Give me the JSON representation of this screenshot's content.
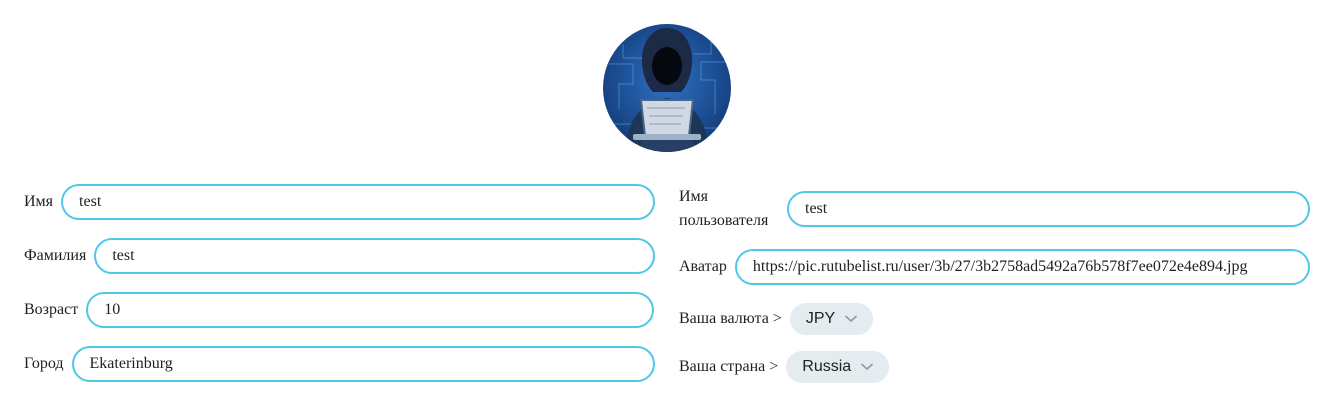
{
  "profile": {
    "avatar_icon": "hacker-avatar-icon",
    "first_name": {
      "label": "Имя",
      "value": "test"
    },
    "last_name": {
      "label": "Фамилия",
      "value": "test"
    },
    "age": {
      "label": "Возраст",
      "value": "10"
    },
    "city": {
      "label": "Город",
      "value": "Ekaterinburg"
    },
    "username": {
      "label_line1": "Имя",
      "label_line2": "пользователя",
      "value": "test"
    },
    "avatar_url": {
      "label": "Аватар",
      "value": "https://pic.rutubelist.ru/user/3b/27/3b2758ad5492a76b578f7ee072e4e894.jpg"
    },
    "currency": {
      "label": "Ваша валюта >",
      "value": "JPY"
    },
    "country": {
      "label": "Ваша страна >",
      "value": "Russia"
    }
  },
  "colors": {
    "input_border": "#4fc7e6",
    "select_bg": "#e4ecf0",
    "avatar_bg": "#1d4e93"
  }
}
